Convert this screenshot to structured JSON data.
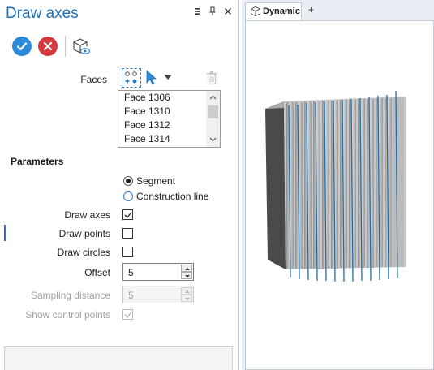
{
  "panel": {
    "title": "Draw axes",
    "header_icons": [
      "menu-icon",
      "pin-icon",
      "close-icon"
    ]
  },
  "actions": {
    "ok_icon": "check-icon",
    "cancel_icon": "x-icon",
    "preview_icon": "preview-cube-icon"
  },
  "faces": {
    "label": "Faces",
    "items": [
      "Face 1306",
      "Face 1310",
      "Face 1312",
      "Face 1314"
    ]
  },
  "parameters": {
    "title": "Parameters",
    "mode_options": [
      "Segment",
      "Construction line"
    ],
    "mode_selected": "Segment",
    "draw_axes_label": "Draw axes",
    "draw_axes_checked": true,
    "draw_points_label": "Draw points",
    "draw_points_checked": false,
    "draw_circles_label": "Draw circles",
    "draw_circles_checked": false,
    "offset_label": "Offset",
    "offset_value": "5",
    "sampling_label": "Sampling distance",
    "sampling_value": "5",
    "show_control_points_label": "Show control points",
    "show_control_points_checked": true
  },
  "viewport": {
    "tab_label": "Dynamic",
    "add_tab_label": "+"
  },
  "colors": {
    "accent": "#1e6fb4",
    "ok": "#2c8ad9",
    "cancel": "#d6393d",
    "axis_line": "#1f6fa8"
  }
}
